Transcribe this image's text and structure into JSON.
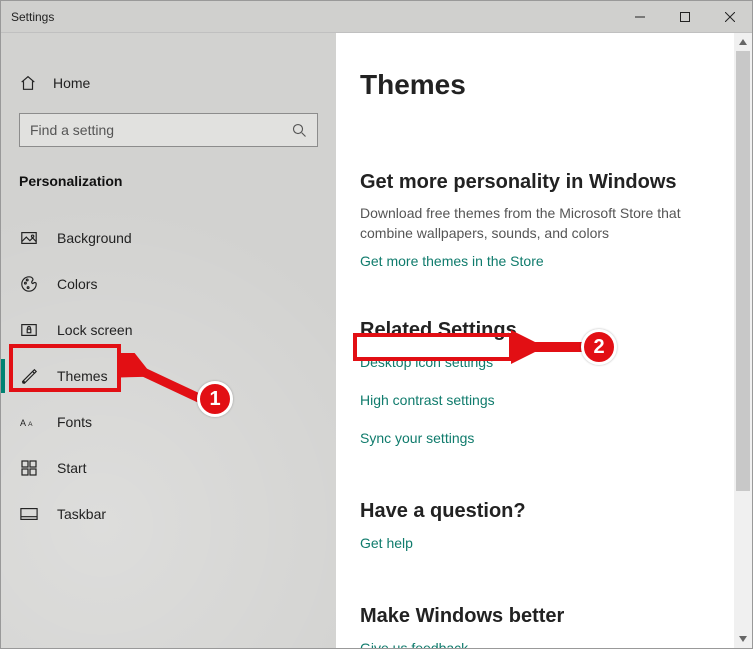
{
  "window": {
    "title": "Settings"
  },
  "sidebar": {
    "home": "Home",
    "search_placeholder": "Find a setting",
    "section": "Personalization",
    "items": [
      {
        "label": "Background"
      },
      {
        "label": "Colors"
      },
      {
        "label": "Lock screen"
      },
      {
        "label": "Themes"
      },
      {
        "label": "Fonts"
      },
      {
        "label": "Start"
      },
      {
        "label": "Taskbar"
      }
    ]
  },
  "main": {
    "title": "Themes",
    "promo": {
      "heading": "Get more personality in Windows",
      "body": "Download free themes from the Microsoft Store that combine wallpapers, sounds, and colors",
      "link": "Get more themes in the Store"
    },
    "related": {
      "heading": "Related Settings",
      "links": [
        "Desktop icon settings",
        "High contrast settings",
        "Sync your settings"
      ]
    },
    "question": {
      "heading": "Have a question?",
      "link": "Get help"
    },
    "feedback": {
      "heading": "Make Windows better",
      "link": "Give us feedback"
    }
  },
  "annotations": {
    "badge1": "1",
    "badge2": "2"
  }
}
